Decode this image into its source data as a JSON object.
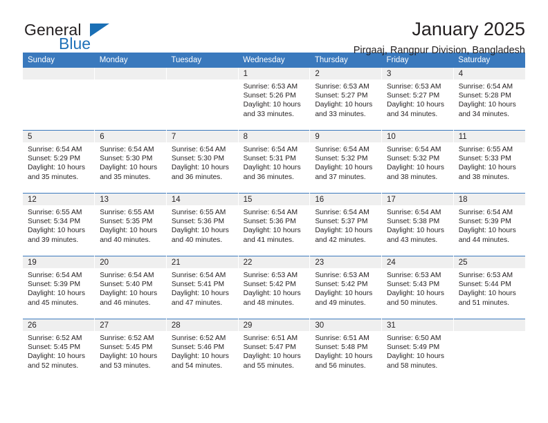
{
  "brand": {
    "name_top": "General",
    "name_bottom": "Blue",
    "flag_icon": "blue-triangle-flag",
    "accent_color": "#1a6fb5"
  },
  "header": {
    "title": "January 2025",
    "subtitle": "Pirgaaj, Rangpur Division, Bangladesh"
  },
  "calendar": {
    "header_bg": "#3a79bd",
    "daynum_bg": "#efefef",
    "weekdays": [
      "Sunday",
      "Monday",
      "Tuesday",
      "Wednesday",
      "Thursday",
      "Friday",
      "Saturday"
    ],
    "weeks": [
      [
        {
          "day": "",
          "empty": true
        },
        {
          "day": "",
          "empty": true
        },
        {
          "day": "",
          "empty": true
        },
        {
          "day": "1",
          "sunrise": "Sunrise: 6:53 AM",
          "sunset": "Sunset: 5:26 PM",
          "daylight_line1": "Daylight: 10 hours",
          "daylight_line2": "and 33 minutes."
        },
        {
          "day": "2",
          "sunrise": "Sunrise: 6:53 AM",
          "sunset": "Sunset: 5:27 PM",
          "daylight_line1": "Daylight: 10 hours",
          "daylight_line2": "and 33 minutes."
        },
        {
          "day": "3",
          "sunrise": "Sunrise: 6:53 AM",
          "sunset": "Sunset: 5:27 PM",
          "daylight_line1": "Daylight: 10 hours",
          "daylight_line2": "and 34 minutes."
        },
        {
          "day": "4",
          "sunrise": "Sunrise: 6:54 AM",
          "sunset": "Sunset: 5:28 PM",
          "daylight_line1": "Daylight: 10 hours",
          "daylight_line2": "and 34 minutes."
        }
      ],
      [
        {
          "day": "5",
          "sunrise": "Sunrise: 6:54 AM",
          "sunset": "Sunset: 5:29 PM",
          "daylight_line1": "Daylight: 10 hours",
          "daylight_line2": "and 35 minutes."
        },
        {
          "day": "6",
          "sunrise": "Sunrise: 6:54 AM",
          "sunset": "Sunset: 5:30 PM",
          "daylight_line1": "Daylight: 10 hours",
          "daylight_line2": "and 35 minutes."
        },
        {
          "day": "7",
          "sunrise": "Sunrise: 6:54 AM",
          "sunset": "Sunset: 5:30 PM",
          "daylight_line1": "Daylight: 10 hours",
          "daylight_line2": "and 36 minutes."
        },
        {
          "day": "8",
          "sunrise": "Sunrise: 6:54 AM",
          "sunset": "Sunset: 5:31 PM",
          "daylight_line1": "Daylight: 10 hours",
          "daylight_line2": "and 36 minutes."
        },
        {
          "day": "9",
          "sunrise": "Sunrise: 6:54 AM",
          "sunset": "Sunset: 5:32 PM",
          "daylight_line1": "Daylight: 10 hours",
          "daylight_line2": "and 37 minutes."
        },
        {
          "day": "10",
          "sunrise": "Sunrise: 6:54 AM",
          "sunset": "Sunset: 5:32 PM",
          "daylight_line1": "Daylight: 10 hours",
          "daylight_line2": "and 38 minutes."
        },
        {
          "day": "11",
          "sunrise": "Sunrise: 6:55 AM",
          "sunset": "Sunset: 5:33 PM",
          "daylight_line1": "Daylight: 10 hours",
          "daylight_line2": "and 38 minutes."
        }
      ],
      [
        {
          "day": "12",
          "sunrise": "Sunrise: 6:55 AM",
          "sunset": "Sunset: 5:34 PM",
          "daylight_line1": "Daylight: 10 hours",
          "daylight_line2": "and 39 minutes."
        },
        {
          "day": "13",
          "sunrise": "Sunrise: 6:55 AM",
          "sunset": "Sunset: 5:35 PM",
          "daylight_line1": "Daylight: 10 hours",
          "daylight_line2": "and 40 minutes."
        },
        {
          "day": "14",
          "sunrise": "Sunrise: 6:55 AM",
          "sunset": "Sunset: 5:36 PM",
          "daylight_line1": "Daylight: 10 hours",
          "daylight_line2": "and 40 minutes."
        },
        {
          "day": "15",
          "sunrise": "Sunrise: 6:54 AM",
          "sunset": "Sunset: 5:36 PM",
          "daylight_line1": "Daylight: 10 hours",
          "daylight_line2": "and 41 minutes."
        },
        {
          "day": "16",
          "sunrise": "Sunrise: 6:54 AM",
          "sunset": "Sunset: 5:37 PM",
          "daylight_line1": "Daylight: 10 hours",
          "daylight_line2": "and 42 minutes."
        },
        {
          "day": "17",
          "sunrise": "Sunrise: 6:54 AM",
          "sunset": "Sunset: 5:38 PM",
          "daylight_line1": "Daylight: 10 hours",
          "daylight_line2": "and 43 minutes."
        },
        {
          "day": "18",
          "sunrise": "Sunrise: 6:54 AM",
          "sunset": "Sunset: 5:39 PM",
          "daylight_line1": "Daylight: 10 hours",
          "daylight_line2": "and 44 minutes."
        }
      ],
      [
        {
          "day": "19",
          "sunrise": "Sunrise: 6:54 AM",
          "sunset": "Sunset: 5:39 PM",
          "daylight_line1": "Daylight: 10 hours",
          "daylight_line2": "and 45 minutes."
        },
        {
          "day": "20",
          "sunrise": "Sunrise: 6:54 AM",
          "sunset": "Sunset: 5:40 PM",
          "daylight_line1": "Daylight: 10 hours",
          "daylight_line2": "and 46 minutes."
        },
        {
          "day": "21",
          "sunrise": "Sunrise: 6:54 AM",
          "sunset": "Sunset: 5:41 PM",
          "daylight_line1": "Daylight: 10 hours",
          "daylight_line2": "and 47 minutes."
        },
        {
          "day": "22",
          "sunrise": "Sunrise: 6:53 AM",
          "sunset": "Sunset: 5:42 PM",
          "daylight_line1": "Daylight: 10 hours",
          "daylight_line2": "and 48 minutes."
        },
        {
          "day": "23",
          "sunrise": "Sunrise: 6:53 AM",
          "sunset": "Sunset: 5:42 PM",
          "daylight_line1": "Daylight: 10 hours",
          "daylight_line2": "and 49 minutes."
        },
        {
          "day": "24",
          "sunrise": "Sunrise: 6:53 AM",
          "sunset": "Sunset: 5:43 PM",
          "daylight_line1": "Daylight: 10 hours",
          "daylight_line2": "and 50 minutes."
        },
        {
          "day": "25",
          "sunrise": "Sunrise: 6:53 AM",
          "sunset": "Sunset: 5:44 PM",
          "daylight_line1": "Daylight: 10 hours",
          "daylight_line2": "and 51 minutes."
        }
      ],
      [
        {
          "day": "26",
          "sunrise": "Sunrise: 6:52 AM",
          "sunset": "Sunset: 5:45 PM",
          "daylight_line1": "Daylight: 10 hours",
          "daylight_line2": "and 52 minutes."
        },
        {
          "day": "27",
          "sunrise": "Sunrise: 6:52 AM",
          "sunset": "Sunset: 5:45 PM",
          "daylight_line1": "Daylight: 10 hours",
          "daylight_line2": "and 53 minutes."
        },
        {
          "day": "28",
          "sunrise": "Sunrise: 6:52 AM",
          "sunset": "Sunset: 5:46 PM",
          "daylight_line1": "Daylight: 10 hours",
          "daylight_line2": "and 54 minutes."
        },
        {
          "day": "29",
          "sunrise": "Sunrise: 6:51 AM",
          "sunset": "Sunset: 5:47 PM",
          "daylight_line1": "Daylight: 10 hours",
          "daylight_line2": "and 55 minutes."
        },
        {
          "day": "30",
          "sunrise": "Sunrise: 6:51 AM",
          "sunset": "Sunset: 5:48 PM",
          "daylight_line1": "Daylight: 10 hours",
          "daylight_line2": "and 56 minutes."
        },
        {
          "day": "31",
          "sunrise": "Sunrise: 6:50 AM",
          "sunset": "Sunset: 5:49 PM",
          "daylight_line1": "Daylight: 10 hours",
          "daylight_line2": "and 58 minutes."
        },
        {
          "day": "",
          "empty": true
        }
      ]
    ]
  }
}
